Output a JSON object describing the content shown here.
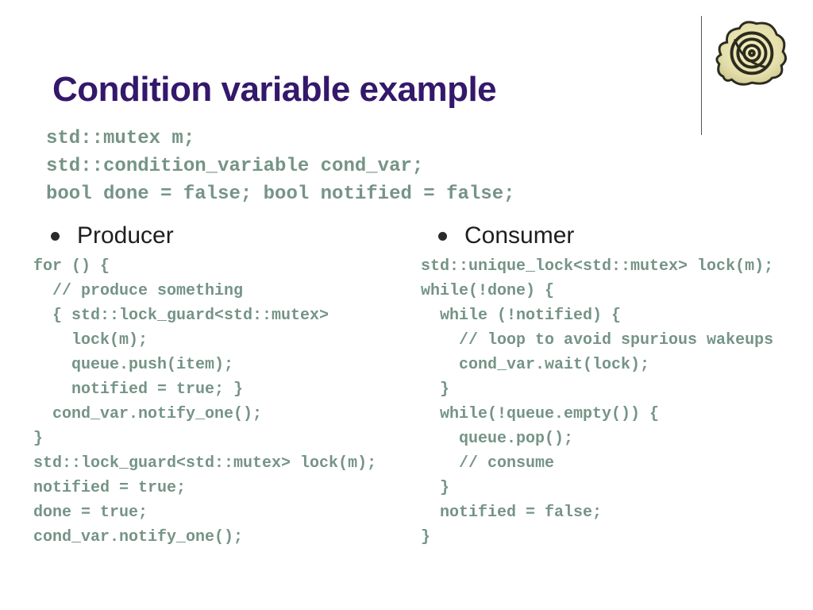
{
  "title": "Condition variable example",
  "decl": {
    "line1": "std::mutex m;",
    "line2": "std::condition_variable cond_var;",
    "line3": "bool done = false; bool notified = false;"
  },
  "producer": {
    "heading": "Producer",
    "code": "for () {\n  // produce something\n  { std::lock_guard<std::mutex>\n    lock(m);\n    queue.push(item);\n    notified = true; }\n  cond_var.notify_one();\n}\nstd::lock_guard<std::mutex> lock(m);\nnotified = true;\ndone = true;\ncond_var.notify_one();"
  },
  "consumer": {
    "heading": "Consumer",
    "code": "std::unique_lock<std::mutex> lock(m);\nwhile(!done) {\n  while (!notified) {\n    // loop to avoid spurious wakeups\n    cond_var.wait(lock);\n  }\n  while(!queue.empty()) {\n    queue.pop();\n    // consume\n  }\n  notified = false;\n}"
  },
  "logo_name": "snail-illustration"
}
